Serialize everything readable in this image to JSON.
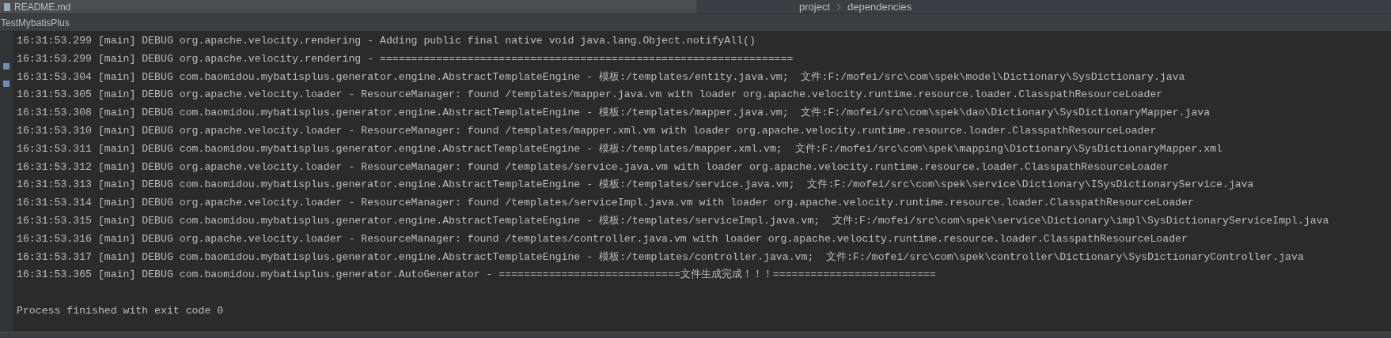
{
  "editor_tab": {
    "label": "README.md"
  },
  "breadcrumb": [
    "project",
    "dependencies"
  ],
  "run_tab": {
    "label": "TestMybatisPlus"
  },
  "console_lines": [
    "16:31:53.299 [main] DEBUG org.apache.velocity.rendering - Adding public final native void java.lang.Object.notifyAll()",
    "16:31:53.299 [main] DEBUG org.apache.velocity.rendering - ==================================================================",
    "16:31:53.304 [main] DEBUG com.baomidou.mybatisplus.generator.engine.AbstractTemplateEngine - 模板:/templates/entity.java.vm;  文件:F:/mofei/src\\com\\spek\\model\\Dictionary\\SysDictionary.java",
    "16:31:53.305 [main] DEBUG org.apache.velocity.loader - ResourceManager: found /templates/mapper.java.vm with loader org.apache.velocity.runtime.resource.loader.ClasspathResourceLoader",
    "16:31:53.308 [main] DEBUG com.baomidou.mybatisplus.generator.engine.AbstractTemplateEngine - 模板:/templates/mapper.java.vm;  文件:F:/mofei/src\\com\\spek\\dao\\Dictionary\\SysDictionaryMapper.java",
    "16:31:53.310 [main] DEBUG org.apache.velocity.loader - ResourceManager: found /templates/mapper.xml.vm with loader org.apache.velocity.runtime.resource.loader.ClasspathResourceLoader",
    "16:31:53.311 [main] DEBUG com.baomidou.mybatisplus.generator.engine.AbstractTemplateEngine - 模板:/templates/mapper.xml.vm;  文件:F:/mofei/src\\com\\spek\\mapping\\Dictionary\\SysDictionaryMapper.xml",
    "16:31:53.312 [main] DEBUG org.apache.velocity.loader - ResourceManager: found /templates/service.java.vm with loader org.apache.velocity.runtime.resource.loader.ClasspathResourceLoader",
    "16:31:53.313 [main] DEBUG com.baomidou.mybatisplus.generator.engine.AbstractTemplateEngine - 模板:/templates/service.java.vm;  文件:F:/mofei/src\\com\\spek\\service\\Dictionary\\ISysDictionaryService.java",
    "16:31:53.314 [main] DEBUG org.apache.velocity.loader - ResourceManager: found /templates/serviceImpl.java.vm with loader org.apache.velocity.runtime.resource.loader.ClasspathResourceLoader",
    "16:31:53.315 [main] DEBUG com.baomidou.mybatisplus.generator.engine.AbstractTemplateEngine - 模板:/templates/serviceImpl.java.vm;  文件:F:/mofei/src\\com\\spek\\service\\Dictionary\\impl\\SysDictionaryServiceImpl.java",
    "16:31:53.316 [main] DEBUG org.apache.velocity.loader - ResourceManager: found /templates/controller.java.vm with loader org.apache.velocity.runtime.resource.loader.ClasspathResourceLoader",
    "16:31:53.317 [main] DEBUG com.baomidou.mybatisplus.generator.engine.AbstractTemplateEngine - 模板:/templates/controller.java.vm;  文件:F:/mofei/src\\com\\spek\\controller\\Dictionary\\SysDictionaryController.java",
    "16:31:53.365 [main] DEBUG com.baomidou.mybatisplus.generator.AutoGenerator - =============================文件生成完成！！！=========================="
  ],
  "exit_message": "Process finished with exit code 0"
}
